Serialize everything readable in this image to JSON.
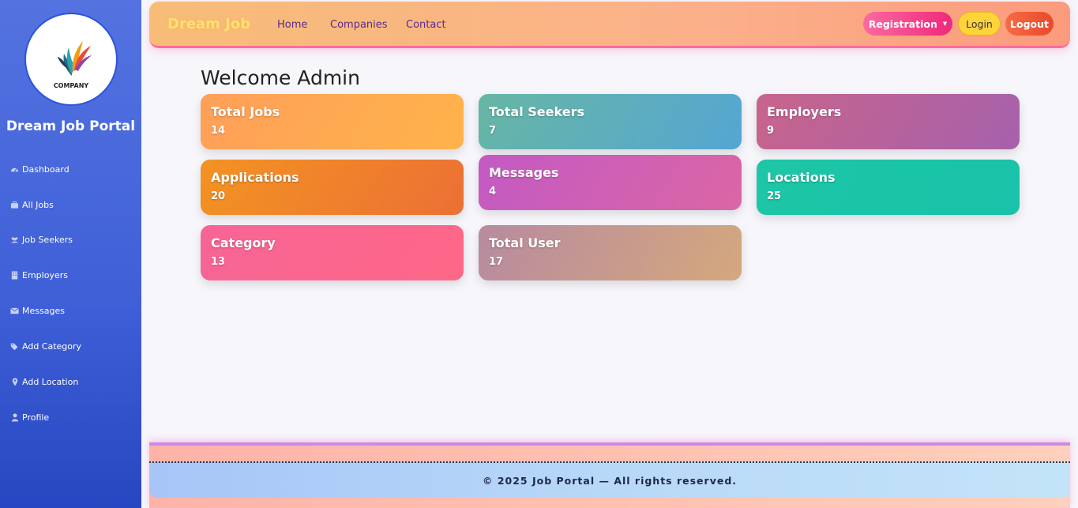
{
  "sidebar": {
    "logo_text": "COMPANY",
    "title": "Dream Job Portal",
    "items": [
      {
        "label": "Dashboard",
        "icon": "dashboard-icon"
      },
      {
        "label": "All Jobs",
        "icon": "briefcase-icon"
      },
      {
        "label": "Job Seekers",
        "icon": "users-icon"
      },
      {
        "label": "Employers",
        "icon": "building-icon"
      },
      {
        "label": "Messages",
        "icon": "envelope-icon"
      },
      {
        "label": "Add Category",
        "icon": "tags-icon"
      },
      {
        "label": "Add Location",
        "icon": "map-marker-icon"
      },
      {
        "label": "Profile",
        "icon": "user-icon"
      }
    ]
  },
  "topbar": {
    "brand": "Dream Job",
    "links": [
      "Home",
      "Companies",
      "Contact"
    ],
    "registration_label": "Registration",
    "login_label": "Login",
    "logout_label": "Logout"
  },
  "main": {
    "welcome": "Welcome Admin",
    "cards": [
      {
        "title": "Total Jobs",
        "value": "14",
        "gradient": [
          "#ff9f5a",
          "#ffb34a"
        ]
      },
      {
        "title": "Total Seekers",
        "value": "7",
        "gradient": [
          "#67b6a4",
          "#55a6d3"
        ]
      },
      {
        "title": "Employers",
        "value": "9",
        "gradient": [
          "#c8648c",
          "#a661ab"
        ]
      },
      {
        "title": "Applications",
        "value": "20",
        "gradient": [
          "#f39322",
          "#ec7035"
        ]
      },
      {
        "title": "Messages",
        "value": "4",
        "gradient": [
          "#c35ac4",
          "#db66a4"
        ]
      },
      {
        "title": "Locations",
        "value": "25",
        "gradient": [
          "#1cc6a6",
          "#19c2a8"
        ]
      },
      {
        "title": "Category",
        "value": "13",
        "gradient": [
          "#f76596",
          "#fe6787"
        ]
      },
      {
        "title": "Total User",
        "value": "17",
        "gradient": [
          "#b78aa0",
          "#d5a87d"
        ]
      }
    ]
  },
  "footer": {
    "text": "© 2025 Job Portal — All rights reserved."
  }
}
